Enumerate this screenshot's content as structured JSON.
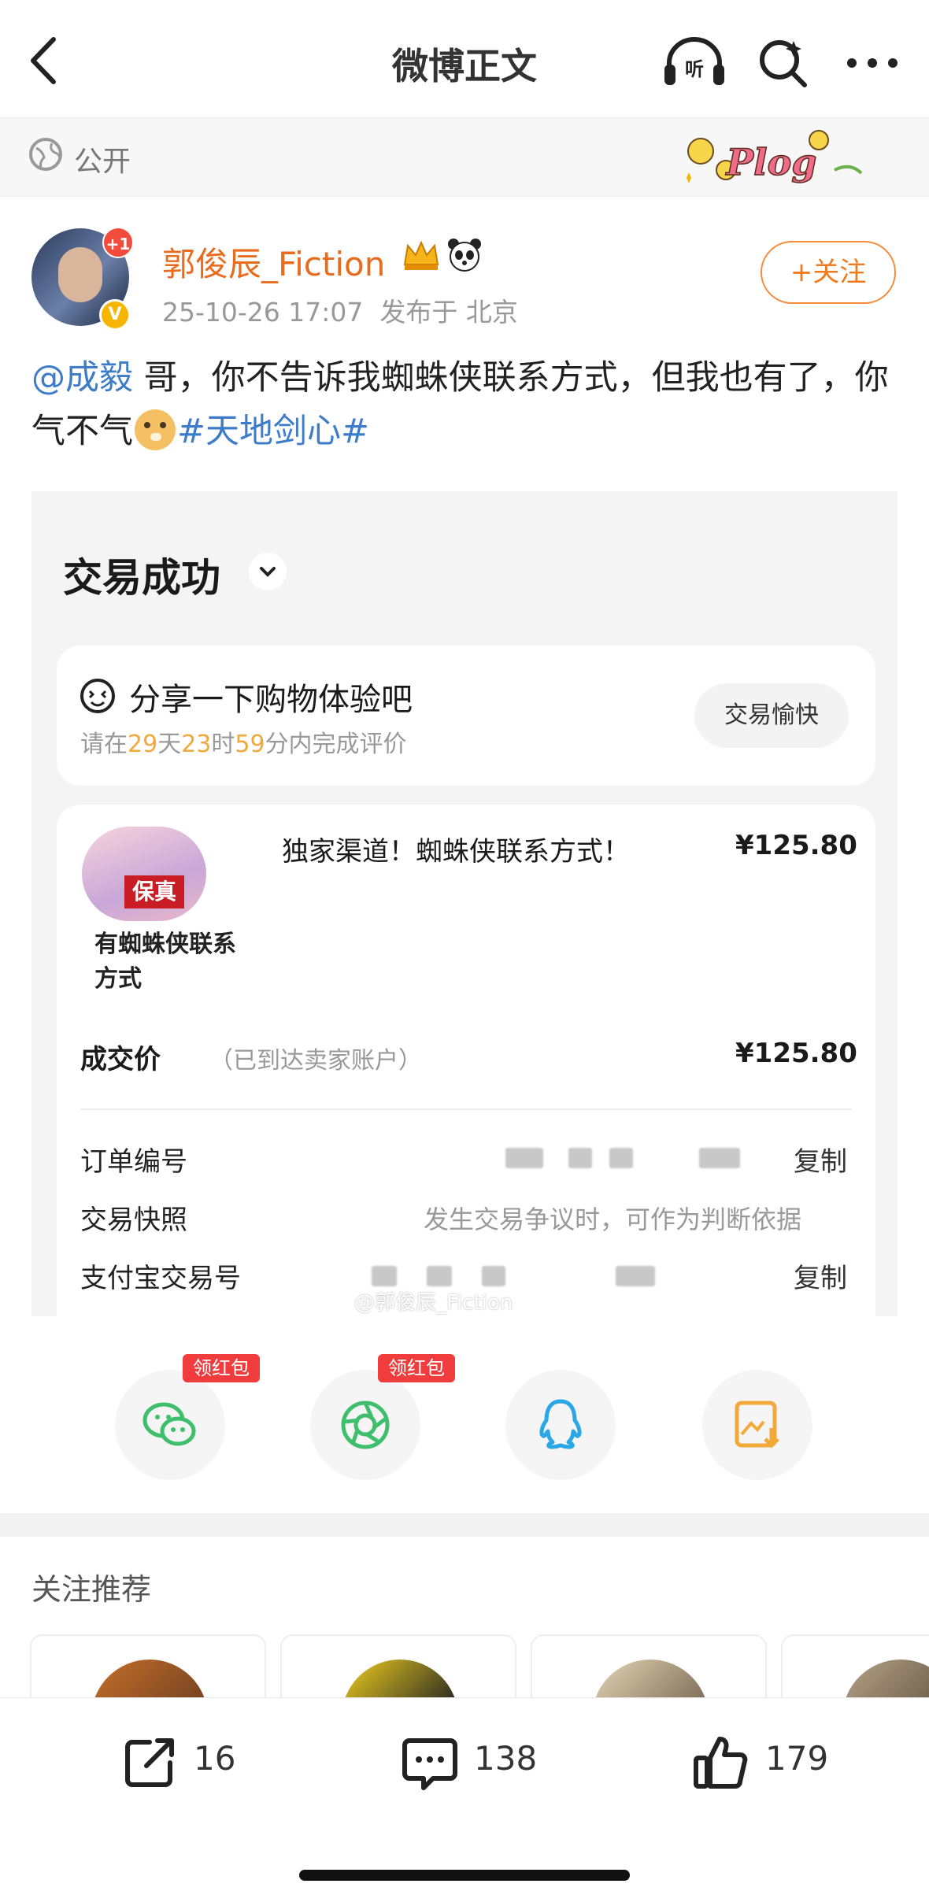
{
  "nav": {
    "title": "微博正文"
  },
  "visibility": {
    "label": "公开",
    "decoration_text": "Plog"
  },
  "author": {
    "name": "郭俊辰_Fiction",
    "badge_plus": "+1",
    "time": "25-10-26 17:07",
    "location": "发布于 北京",
    "follow_label": "+关注"
  },
  "post": {
    "mention": "@成毅",
    "text_1": " 哥，你不告诉我蜘蛛侠联系方式，但我也有了，你气不气",
    "hashtag": "#天地剑心#"
  },
  "screenshot": {
    "status_title": "交易成功",
    "share_title": "分享一下购物体验吧",
    "share_sub_prefix": "请在",
    "days": "29",
    "days_unit": "天",
    "hours": "23",
    "hours_unit": "时",
    "minutes": "59",
    "share_sub_suffix": "分内完成评价",
    "happy_button": "交易愉快",
    "thumb_stamp": "保真",
    "thumb_text": "有蜘蛛侠联系方式",
    "product_title": "独家渠道！蜘蛛侠联系方式！",
    "product_price": "¥125.80",
    "deal_label": "成交价",
    "deal_note": "（已到达卖家账户）",
    "deal_price": "¥125.80",
    "order_label": "订单编号",
    "copy_label": "复制",
    "snapshot_label": "交易快照",
    "snapshot_hint": "发生交易争议时，可作为判断依据",
    "alipay_label": "支付宝交易号",
    "watermark": "@郭俊辰_Fiction"
  },
  "share": {
    "redpack_label": "领红包",
    "targets": [
      "wechat-icon",
      "moments-icon",
      "qq-icon",
      "save-image-icon"
    ]
  },
  "recommend": {
    "title": "关注推荐"
  },
  "actions": {
    "repost_count": "16",
    "comment_count": "138",
    "like_count": "179"
  },
  "colors": {
    "accent_orange": "#f07a1e",
    "link_blue": "#3d7cc9",
    "wechat_green": "#3fbf6b",
    "qq_blue": "#2aa7e6",
    "save_orange": "#f3a83a",
    "redpack_red": "#f03c3c"
  }
}
